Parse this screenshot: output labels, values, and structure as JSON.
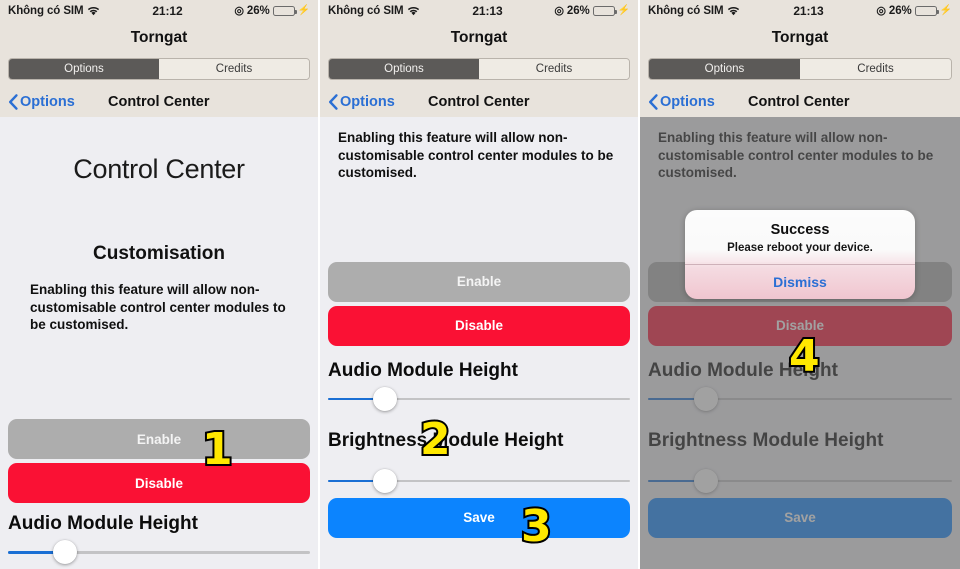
{
  "app": {
    "title": "Torngat",
    "tabs": [
      {
        "label": "Options",
        "selected": true
      },
      {
        "label": "Credits",
        "selected": false
      }
    ],
    "back_label": "Options",
    "page_title": "Control Center"
  },
  "status_bar": {
    "carrier": "Không có SIM",
    "wifi_icon": "wifi-icon",
    "time_p1": "21:12",
    "time_p2": "21:13",
    "time_p3": "21:13",
    "rotation_lock_icon": "rotation-lock-icon",
    "battery_percent": "26%",
    "battery_level": 26,
    "charging_icon": "charging-bolt-icon",
    "battery_color": "#4cd65c"
  },
  "screen": {
    "hero_title": "Control Center",
    "section_title": "Customisation",
    "description": "Enabling this feature will allow non-customisable control center modules to be customised.",
    "enable_label": "Enable",
    "disable_label": "Disable",
    "save_label": "Save",
    "audio_label": "Audio Module Height",
    "brightness_label": "Brightness Module Height",
    "audio_value": 19,
    "brightness_value": 19
  },
  "alert": {
    "title": "Success",
    "message": "Please reboot your device.",
    "dismiss_label": "Dismiss"
  },
  "steps": {
    "one": "1",
    "two": "2",
    "three": "3",
    "four": "4"
  },
  "colors": {
    "enable": "#adadad",
    "disable": "#fa1134",
    "save": "#0c84fe",
    "accent_blue": "#2b6fd4",
    "badge_yellow": "#ffe800",
    "status_bg": "#e8e3dc",
    "content_bg": "#eeeef2"
  }
}
